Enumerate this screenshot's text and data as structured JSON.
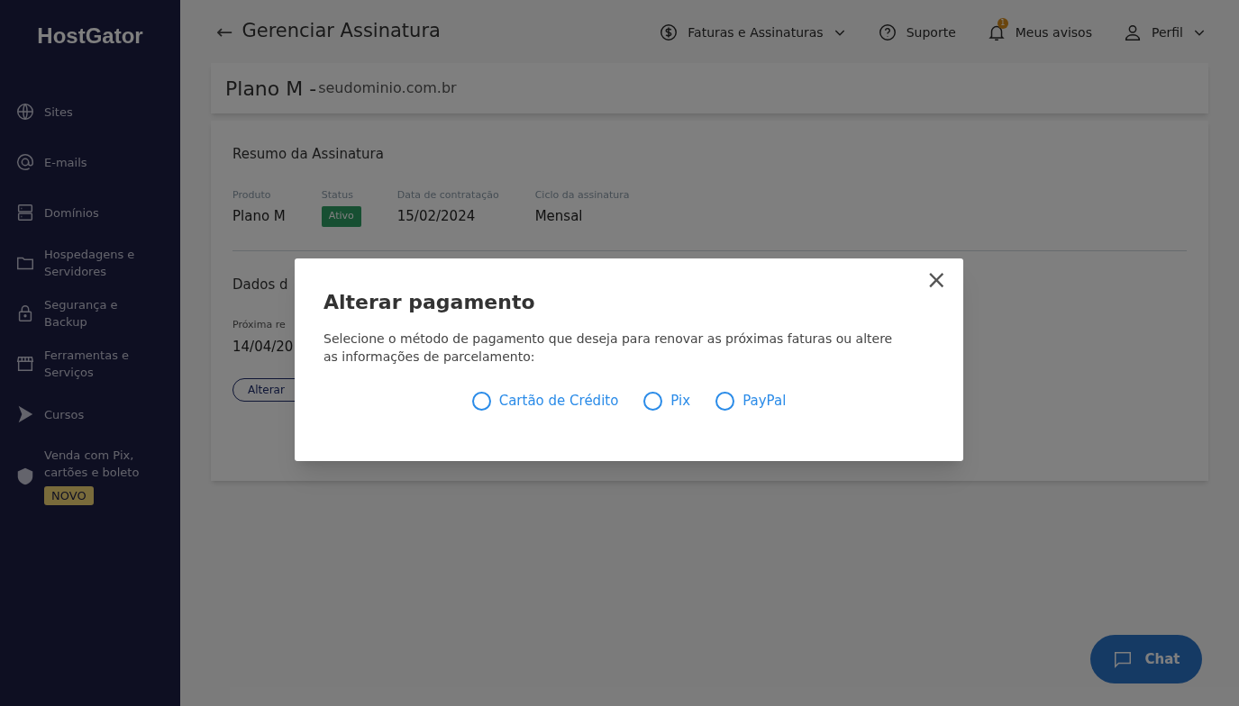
{
  "sidebar": {
    "logo": "HostGator",
    "items": [
      {
        "kind": "globe",
        "label": "Sites"
      },
      {
        "kind": "at",
        "label": "E-mails"
      },
      {
        "kind": "server",
        "label": "Domínios"
      },
      {
        "kind": "folder",
        "label": "Hospedagens e Servidores"
      },
      {
        "kind": "lock",
        "label": "Segurança e Backup"
      },
      {
        "kind": "store",
        "label": "Ferramentas e Serviços"
      },
      {
        "kind": "play",
        "label": "Cursos"
      },
      {
        "kind": "shield",
        "label": "Venda com Pix, cartões e boleto",
        "badge": "NOVO"
      }
    ]
  },
  "header": {
    "back": "←",
    "title": "Gerenciar Assinatura",
    "nav": [
      {
        "kind": "dollar",
        "label": "Faturas e Assinaturas",
        "dropdown": true
      },
      {
        "kind": "help",
        "label": "Suporte",
        "dropdown": false
      },
      {
        "kind": "bell",
        "label": "Meus avisos",
        "dropdown": false,
        "count": "1"
      },
      {
        "kind": "user",
        "label": "Perfil",
        "dropdown": true
      }
    ]
  },
  "plan": {
    "name": "Plano M - ",
    "domain": "seudominio.com.br"
  },
  "summary": {
    "title": "Resumo da Assinatura",
    "fields": [
      {
        "kind": "text",
        "label": "Produto",
        "value": "Plano M"
      },
      {
        "kind": "badge",
        "label": "Status",
        "value": "Ativo"
      },
      {
        "kind": "text",
        "label": "Data de contratação",
        "value": "15/02/2024"
      },
      {
        "kind": "text",
        "label": "Ciclo da assinatura",
        "value": "Mensal"
      }
    ],
    "section_2": {
      "title": "Dados d",
      "label": "Próxima re",
      "value": "14/04/20",
      "button": "Alterar"
    }
  },
  "dialog": {
    "title": "Alterar pagamento",
    "close": "×",
    "text": "Selecione o método de pagamento que deseja para renovar as próximas faturas ou altere as informações de parcelamento:",
    "options": [
      {
        "label": "Cartão de Crédito",
        "selected": false
      },
      {
        "label": "Pix",
        "selected": false
      },
      {
        "label": "PayPal",
        "selected": false
      }
    ]
  },
  "chat": {
    "label": "Chat"
  }
}
